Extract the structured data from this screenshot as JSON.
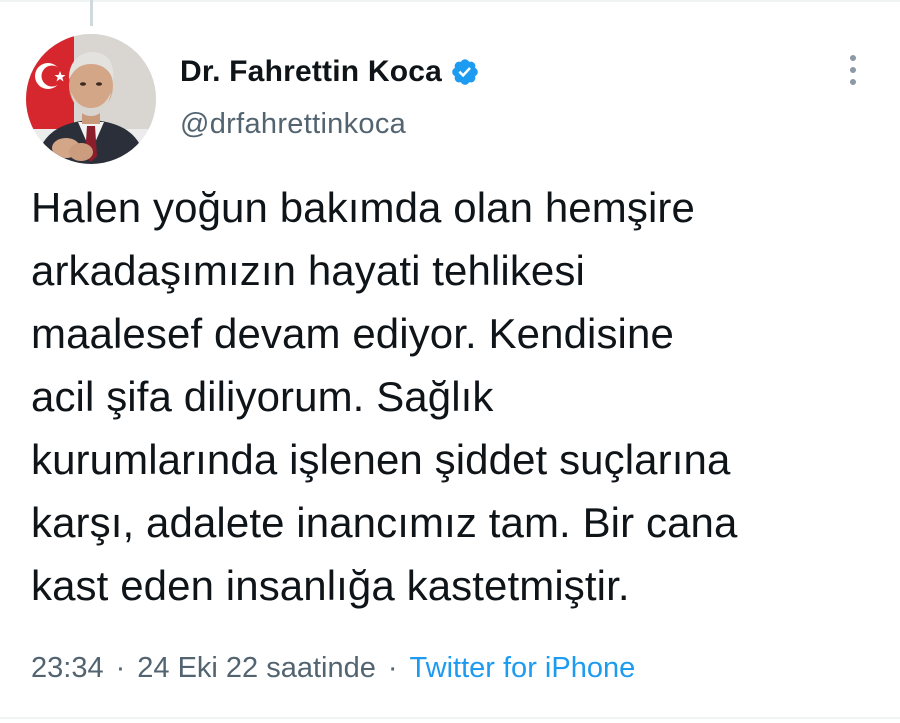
{
  "tweet": {
    "author": {
      "display_name": "Dr. Fahrettin Koca",
      "handle": "@drfahrettinkoca",
      "verified": true,
      "avatar_icon": "profile-photo"
    },
    "text": "Halen yoğun bakımda olan hemşire\narkadaşımızın hayati tehlikesi\nmaalesef devam ediyor. Kendisine\nacil şifa diliyorum. Sağlık\nkurumlarında işlenen şiddet suçlarına\nkarşı, adalete inancımız tam. Bir cana\nkast eden insanlığa kastetmiştir.",
    "time": "23:34",
    "date": "24 Eki 22 saatinde",
    "separator": "·",
    "source": "Twitter for iPhone"
  },
  "colors": {
    "text_primary": "#0f1419",
    "text_secondary": "#536471",
    "accent": "#1d9bf0"
  },
  "icons": {
    "verified": "verified-badge-icon",
    "more": "more-vertical-icon"
  }
}
